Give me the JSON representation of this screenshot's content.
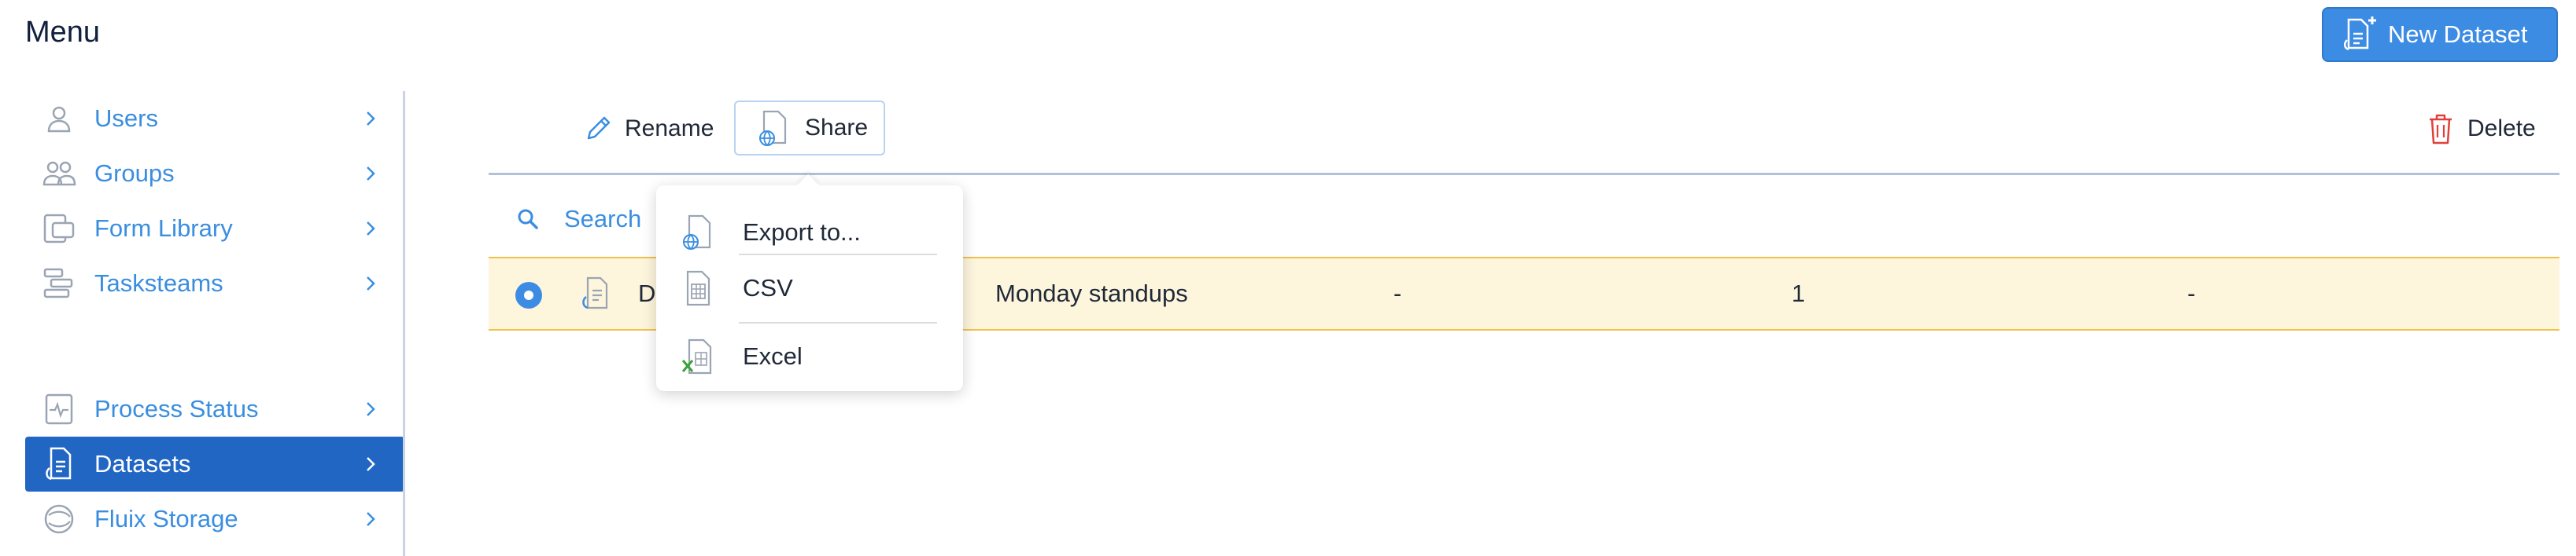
{
  "header": {
    "title": "Menu"
  },
  "new_dataset_button": {
    "label": "New Dataset"
  },
  "sidebar": {
    "items": [
      {
        "label": "Users",
        "icon": "user-icon"
      },
      {
        "label": "Groups",
        "icon": "groups-icon"
      },
      {
        "label": "Form Library",
        "icon": "form-library-icon"
      },
      {
        "label": "Tasksteams",
        "icon": "taskstreams-icon"
      },
      {
        "label": "Process Status",
        "icon": "process-status-icon"
      },
      {
        "label": "Datasets",
        "icon": "datasets-icon",
        "active": true
      },
      {
        "label": "Fluix Storage",
        "icon": "storage-icon"
      }
    ]
  },
  "toolbar": {
    "rename_label": "Rename",
    "share_label": "Share",
    "delete_label": "Delete"
  },
  "search": {
    "label": "Search"
  },
  "table": {
    "rows": [
      {
        "name_prefix": "D",
        "description": "Monday standups",
        "col3": "-",
        "col4": "1",
        "col5": "-",
        "selected": true
      }
    ]
  },
  "share_menu": {
    "items": [
      {
        "label": "Export to...",
        "icon": "export-globe-icon"
      },
      {
        "label": "CSV",
        "icon": "csv-file-icon"
      },
      {
        "label": "Excel",
        "icon": "excel-file-icon"
      }
    ]
  },
  "colors": {
    "accent": "#3a8ee0",
    "active_nav": "#2266c4",
    "selected_row": "#fdf5dc",
    "selected_row_border": "#f0c14d",
    "delete_red": "#e0403a",
    "excel_green": "#3aa23a"
  }
}
